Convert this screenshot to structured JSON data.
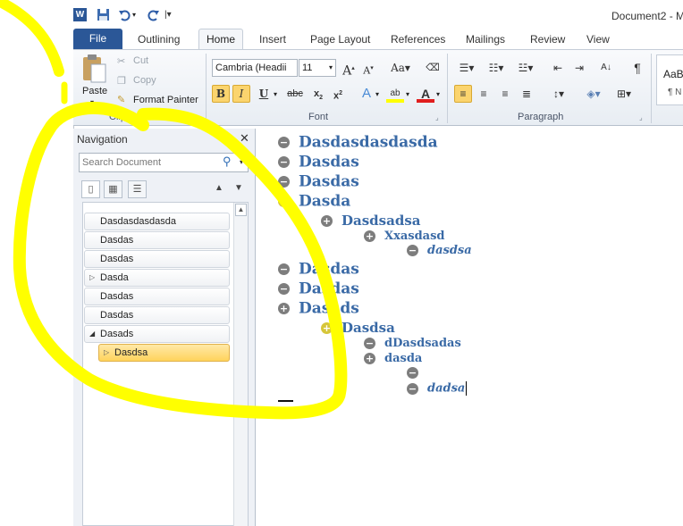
{
  "title_bar": {
    "document_title": "Document2 - M"
  },
  "quick_access": {
    "icons": [
      "word-logo-icon",
      "save-icon",
      "undo-icon",
      "redo-icon",
      "customize-qat-icon"
    ]
  },
  "tabs": {
    "file": "File",
    "items": [
      "Outlining",
      "Home",
      "Insert",
      "Page Layout",
      "References",
      "Mailings",
      "Review",
      "View"
    ]
  },
  "ribbon": {
    "clipboard": {
      "paste": "Paste",
      "cut": "Cut",
      "copy": "Copy",
      "format_painter": "Format Painter",
      "label": "Clipboard"
    },
    "font": {
      "font_name": "Cambria (Headii",
      "font_size": "11",
      "label": "Font"
    },
    "paragraph": {
      "label": "Paragraph"
    },
    "styles": {
      "preview_top": "AaB",
      "preview_bottom": "¶ N"
    }
  },
  "navigation": {
    "title": "Navigation",
    "search_placeholder": "Search Document",
    "items": [
      {
        "label": "Dasdasdasdasda",
        "expander": ""
      },
      {
        "label": "Dasdas",
        "expander": ""
      },
      {
        "label": "Dasdas",
        "expander": ""
      },
      {
        "label": "Dasda",
        "expander": "▷"
      },
      {
        "label": "Dasdas",
        "expander": ""
      },
      {
        "label": "Dasdas",
        "expander": ""
      },
      {
        "label": "Dasads",
        "expander": "◢"
      },
      {
        "label": "Dasdsa",
        "expander": "▷",
        "selected": true
      }
    ]
  },
  "outline": [
    {
      "sym": "−",
      "text": "Dasdasdasdasda",
      "level": 1
    },
    {
      "sym": "−",
      "text": "Dasdas",
      "level": 1
    },
    {
      "sym": "−",
      "text": "Dasdas",
      "level": 1
    },
    {
      "sym": "+",
      "text": "Dasda",
      "level": 1,
      "highlight": true
    },
    {
      "sym": "+",
      "text": "Dasdsadsa",
      "level": 2
    },
    {
      "sym": "+",
      "text": "Xxasdasd",
      "level": 3
    },
    {
      "sym": "−",
      "text": "dasdsa",
      "level": 4
    },
    {
      "sym": "−",
      "text": "Dasdas",
      "level": 1
    },
    {
      "sym": "−",
      "text": "Dasdas",
      "level": 1
    },
    {
      "sym": "+",
      "text": "Dasads",
      "level": 1
    },
    {
      "sym": "+",
      "text": "Dasdsa",
      "level": 2,
      "highlight": true
    },
    {
      "sym": "−",
      "text": "dDasdsadas",
      "level": 3
    },
    {
      "sym": "+",
      "text": "dasda",
      "level": 3
    },
    {
      "sym": "−",
      "text": "",
      "level": 4
    },
    {
      "sym": "−",
      "text": "dadsa",
      "level": 4
    }
  ],
  "colors": {
    "file_tab": "#2b5797",
    "heading_text": "#3a6aa6",
    "annotation": "#ffff00",
    "selected_nav": "#ffd35c"
  }
}
